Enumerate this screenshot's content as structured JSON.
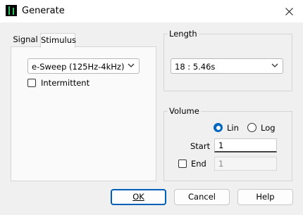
{
  "window": {
    "title": "Generate"
  },
  "tabs": [
    {
      "label": "Signal",
      "selected": false
    },
    {
      "label": "Stimulus",
      "selected": true
    }
  ],
  "stimulus": {
    "signal_type": "e-Sweep (125Hz-4kHz)",
    "intermittent_label": "Intermittent",
    "intermittent_checked": false
  },
  "length": {
    "label": "Length",
    "value": "18 : 5.46s"
  },
  "volume": {
    "label": "Volume",
    "lin_label": "Lin",
    "log_label": "Log",
    "selected_scale": "Lin",
    "start_label": "Start",
    "start_value": "1",
    "end_label": "End",
    "end_checked": false,
    "end_value": "1"
  },
  "buttons": {
    "ok": "OK",
    "cancel": "Cancel",
    "help": "Help"
  },
  "colors": {
    "accent": "#0067c0",
    "app_icon_wave": "#22c55e"
  }
}
